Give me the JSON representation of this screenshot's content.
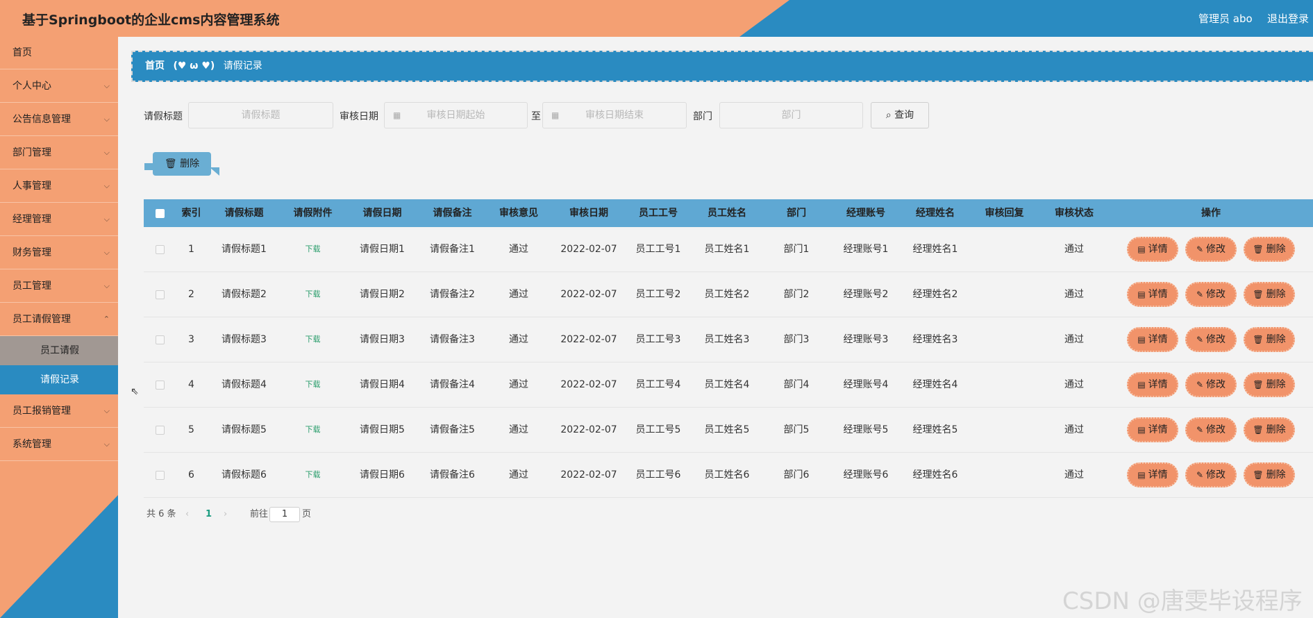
{
  "header": {
    "title": "基于Springboot的企业cms内容管理系统",
    "admin": "管理员 abo",
    "logout": "退出登录"
  },
  "sidebar": {
    "items": [
      {
        "label": "首页"
      },
      {
        "label": "个人中心"
      },
      {
        "label": "公告信息管理"
      },
      {
        "label": "部门管理"
      },
      {
        "label": "人事管理"
      },
      {
        "label": "经理管理"
      },
      {
        "label": "财务管理"
      },
      {
        "label": "员工管理"
      },
      {
        "label": "员工请假管理"
      },
      {
        "label": "员工报销管理"
      },
      {
        "label": "系统管理"
      }
    ],
    "sub_items": [
      {
        "label": "员工请假"
      },
      {
        "label": "请假记录"
      }
    ]
  },
  "breadcrumb": {
    "home": "首页",
    "sep": "(♥ ω ♥)",
    "current": "请假记录"
  },
  "search": {
    "title_label": "请假标题",
    "title_placeholder": "请假标题",
    "date_label": "审核日期",
    "date_start_placeholder": "审核日期起始",
    "to": "至",
    "date_end_placeholder": "审核日期结束",
    "dept_label": "部门",
    "dept_placeholder": "部门",
    "query_label": "查询"
  },
  "toolbar": {
    "delete_label": "删除"
  },
  "table": {
    "headers": [
      "",
      "索引",
      "请假标题",
      "请假附件",
      "请假日期",
      "请假备注",
      "审核意见",
      "审核日期",
      "员工工号",
      "员工姓名",
      "部门",
      "经理账号",
      "经理姓名",
      "审核回复",
      "审核状态",
      "操作"
    ],
    "rows": [
      {
        "index": "1",
        "title": "请假标题1",
        "attachment": "下载",
        "date": "请假日期1",
        "note": "请假备注1",
        "opinion": "通过",
        "audit_date": "2022-02-07",
        "emp_no": "员工工号1",
        "emp_name": "员工姓名1",
        "dept": "部门1",
        "mgr_acc": "经理账号1",
        "mgr_name": "经理姓名1",
        "reply": "",
        "status": "通过"
      },
      {
        "index": "2",
        "title": "请假标题2",
        "attachment": "下载",
        "date": "请假日期2",
        "note": "请假备注2",
        "opinion": "通过",
        "audit_date": "2022-02-07",
        "emp_no": "员工工号2",
        "emp_name": "员工姓名2",
        "dept": "部门2",
        "mgr_acc": "经理账号2",
        "mgr_name": "经理姓名2",
        "reply": "",
        "status": "通过"
      },
      {
        "index": "3",
        "title": "请假标题3",
        "attachment": "下载",
        "date": "请假日期3",
        "note": "请假备注3",
        "opinion": "通过",
        "audit_date": "2022-02-07",
        "emp_no": "员工工号3",
        "emp_name": "员工姓名3",
        "dept": "部门3",
        "mgr_acc": "经理账号3",
        "mgr_name": "经理姓名3",
        "reply": "",
        "status": "通过"
      },
      {
        "index": "4",
        "title": "请假标题4",
        "attachment": "下载",
        "date": "请假日期4",
        "note": "请假备注4",
        "opinion": "通过",
        "audit_date": "2022-02-07",
        "emp_no": "员工工号4",
        "emp_name": "员工姓名4",
        "dept": "部门4",
        "mgr_acc": "经理账号4",
        "mgr_name": "经理姓名4",
        "reply": "",
        "status": "通过"
      },
      {
        "index": "5",
        "title": "请假标题5",
        "attachment": "下载",
        "date": "请假日期5",
        "note": "请假备注5",
        "opinion": "通过",
        "audit_date": "2022-02-07",
        "emp_no": "员工工号5",
        "emp_name": "员工姓名5",
        "dept": "部门5",
        "mgr_acc": "经理账号5",
        "mgr_name": "经理姓名5",
        "reply": "",
        "status": "通过"
      },
      {
        "index": "6",
        "title": "请假标题6",
        "attachment": "下载",
        "date": "请假日期6",
        "note": "请假备注6",
        "opinion": "通过",
        "audit_date": "2022-02-07",
        "emp_no": "员工工号6",
        "emp_name": "员工姓名6",
        "dept": "部门6",
        "mgr_acc": "经理账号6",
        "mgr_name": "经理姓名6",
        "reply": "",
        "status": "通过"
      }
    ],
    "actions": {
      "detail": "详情",
      "edit": "修改",
      "delete": "删除"
    }
  },
  "pagination": {
    "total": "共 6 条",
    "current_page": "1",
    "goto_label": "前往",
    "goto_value": "1",
    "page_suffix": "页"
  },
  "watermark": "CSDN @唐雯毕设程序",
  "colors": {
    "orange": "#f4a073",
    "blue": "#2a8bc1",
    "table_header": "#5fa8d3",
    "action_button": "#f1936a"
  }
}
